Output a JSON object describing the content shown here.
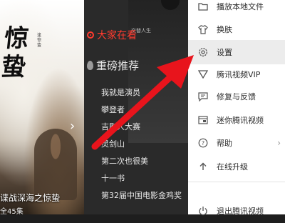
{
  "poster": {
    "calligraphy": [
      "惊",
      "蛰"
    ],
    "side_text": "逢惊蛰",
    "top_credit": "交替人生",
    "caption": "谍战深海之惊蛰",
    "subcaption": "全45集"
  },
  "mid_panel": {
    "hot_section_title": "大家在看",
    "rank_section_title": "重磅推荐",
    "rank_items": [
      "我就是演员",
      "攀登者",
      "吉剧人大赛",
      "灵剑山",
      "第二次也很美",
      "十一书",
      "第32届中国电影金鸡奖"
    ]
  },
  "menu": {
    "items": [
      {
        "label": "播放本地文件",
        "icon": "folder-icon"
      },
      {
        "label": "换肤",
        "icon": "shirt-icon"
      },
      {
        "label": "设置",
        "icon": "gear-icon"
      },
      {
        "label": "腾讯视频VIP",
        "icon": "vip-icon"
      },
      {
        "label": "修复与反馈",
        "icon": "feedback-icon"
      },
      {
        "label": "迷你腾讯视频",
        "icon": "mini-window-icon"
      },
      {
        "label": "帮助",
        "icon": "help-icon"
      },
      {
        "label": "在线升级",
        "icon": "upgrade-arrow-icon"
      },
      {
        "label": "退出腾讯视频",
        "icon": "power-icon"
      }
    ],
    "hovered_item": "设置"
  },
  "colors": {
    "accent_red": "#ff3b2f",
    "annotation_arrow": "#e8141c",
    "menu_background": "#ffffff",
    "dark_panel": "#2a2a2a"
  }
}
